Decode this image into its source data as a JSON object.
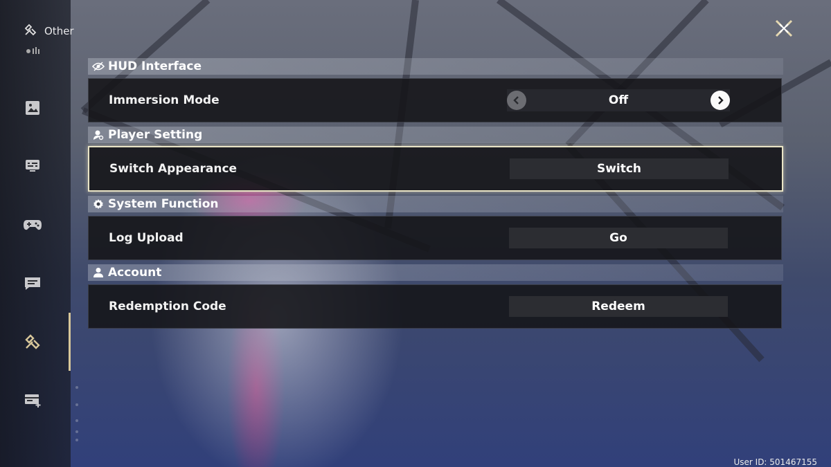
{
  "header": {
    "title": "Other"
  },
  "nav_icons": [
    "picture-icon",
    "display-settings-icon",
    "gamepad-icon",
    "chat-icon",
    "other-icon",
    "card-add-icon"
  ],
  "active_nav": "other-icon",
  "sections": [
    {
      "id": "hud",
      "label": "HUD Interface",
      "icon": "eye-icon"
    },
    {
      "id": "player",
      "label": "Player Setting",
      "icon": "player-icon"
    },
    {
      "id": "system",
      "label": "System Function",
      "icon": "gear-icon"
    },
    {
      "id": "account",
      "label": "Account",
      "icon": "person-icon"
    }
  ],
  "rows": {
    "immersion": {
      "label": "Immersion Mode",
      "value": "Off"
    },
    "appearance": {
      "label": "Switch Appearance",
      "button": "Switch"
    },
    "log": {
      "label": "Log Upload",
      "button": "Go"
    },
    "redemption": {
      "label": "Redemption Code",
      "button": "Redeem"
    }
  },
  "footer": {
    "user_id": "User ID: 501467155"
  },
  "colors": {
    "accent": "#d8c79a",
    "row_bg": "#141418",
    "selected_border": "#e9e4c6"
  }
}
